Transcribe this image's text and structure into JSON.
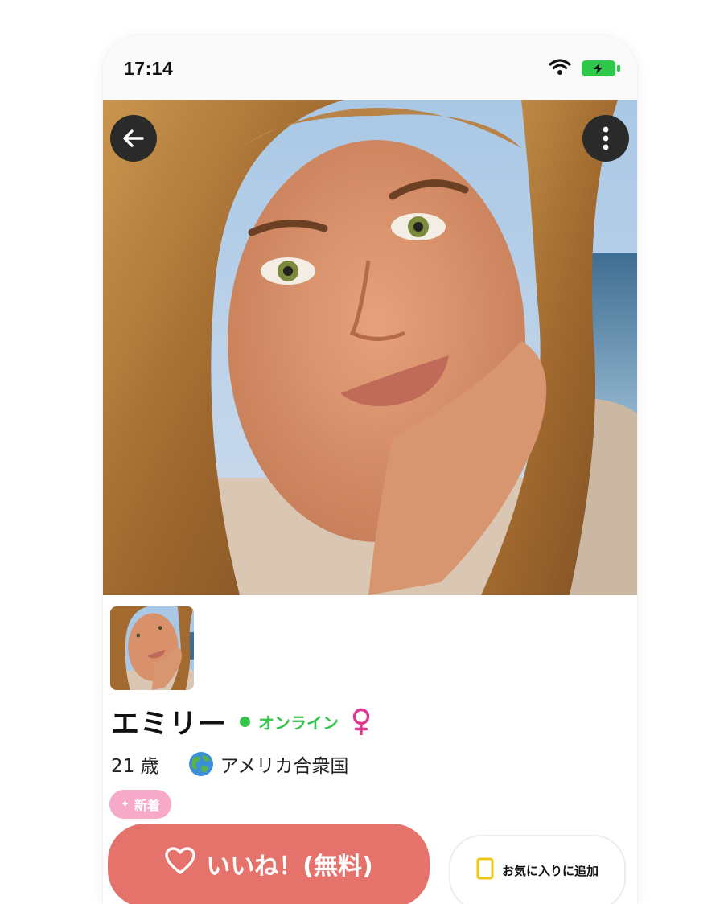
{
  "status_bar": {
    "time": "17:14"
  },
  "profile": {
    "name": "エミリー",
    "online_label": "オンライン",
    "age_label": "21 歳",
    "country": "アメリカ合衆国",
    "badge_label": "新着"
  },
  "actions": {
    "like_label": "いいね！(無料)",
    "favorite_label": "お気に入りに追加"
  },
  "icons": {
    "back": "arrow-left-icon",
    "more": "more-vertical-icon",
    "gender": "female-icon",
    "country": "globe-icon",
    "like": "heart-icon",
    "favorite": "bookmark-icon"
  },
  "colors": {
    "online": "#34c44a",
    "gender": "#e0348f",
    "badge": "#f6a9c9",
    "like_button": "#e5736c",
    "battery": "#2fc84a"
  }
}
